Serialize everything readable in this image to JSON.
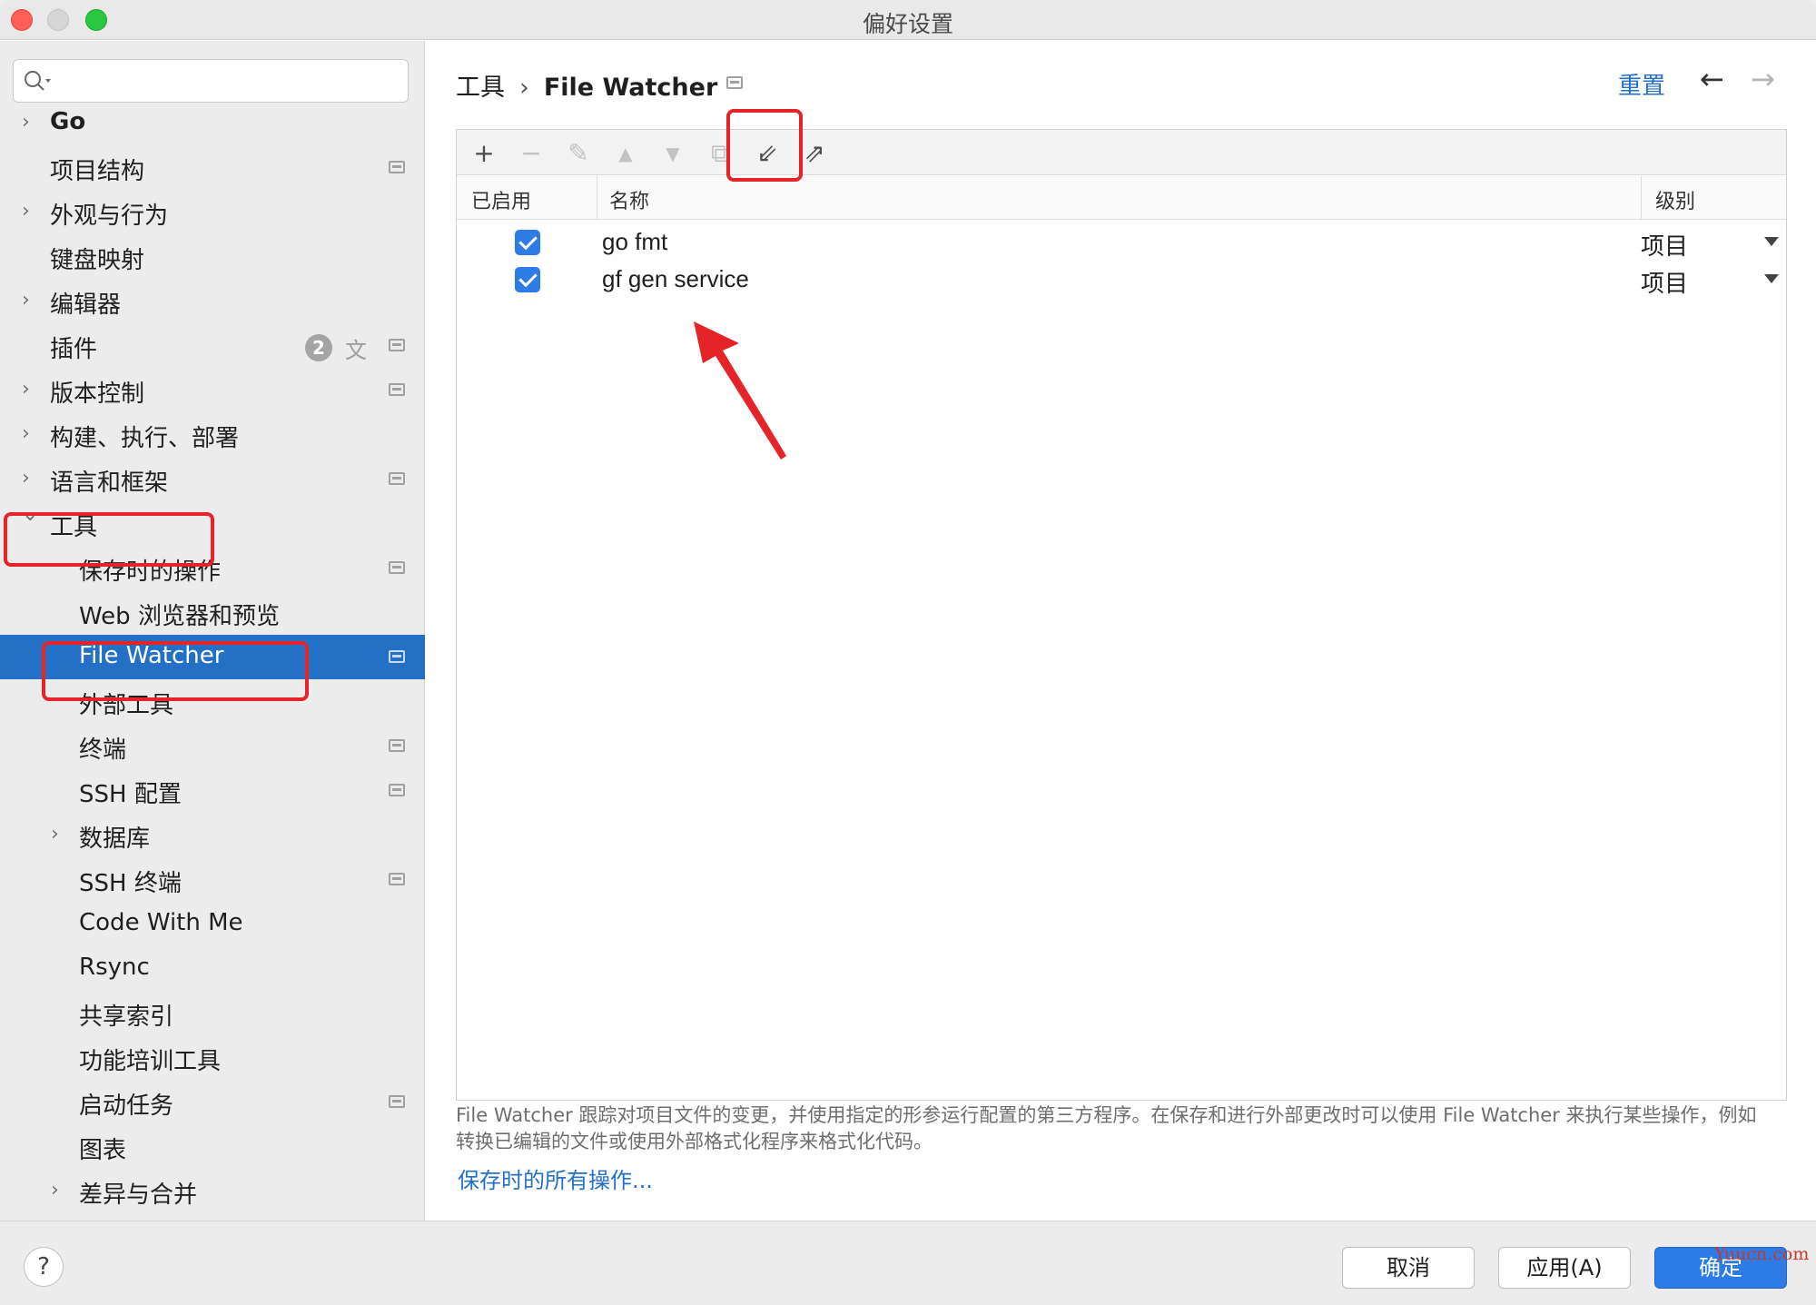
{
  "window": {
    "title": "偏好设置"
  },
  "sidebar": {
    "search_placeholder": "",
    "items": [
      {
        "label": "Go",
        "bold": true,
        "expander": "collapsed",
        "project_icon": false
      },
      {
        "label": "项目结构",
        "expander": "none",
        "project_icon": true
      },
      {
        "label": "外观与行为",
        "expander": "collapsed",
        "project_icon": false
      },
      {
        "label": "键盘映射",
        "expander": "none",
        "project_icon": false
      },
      {
        "label": "编辑器",
        "expander": "collapsed",
        "project_icon": false
      },
      {
        "label": "插件",
        "expander": "none",
        "project_icon": true,
        "badge": "2"
      },
      {
        "label": "版本控制",
        "expander": "collapsed",
        "project_icon": true
      },
      {
        "label": "构建、执行、部署",
        "expander": "collapsed",
        "project_icon": false
      },
      {
        "label": "语言和框架",
        "expander": "collapsed",
        "project_icon": true
      },
      {
        "label": "工具",
        "expander": "expanded",
        "project_icon": false,
        "highlighted": true
      },
      {
        "label": "保存时的操作",
        "expander": "none",
        "indent": 1,
        "project_icon": true
      },
      {
        "label": "Web 浏览器和预览",
        "expander": "none",
        "indent": 1,
        "project_icon": false
      },
      {
        "label": "File Watcher",
        "expander": "none",
        "indent": 1,
        "project_icon": true,
        "selected": true,
        "highlighted": true
      },
      {
        "label": "外部工具",
        "expander": "none",
        "indent": 1,
        "project_icon": false
      },
      {
        "label": "终端",
        "expander": "none",
        "indent": 1,
        "project_icon": true
      },
      {
        "label": "SSH 配置",
        "expander": "none",
        "indent": 1,
        "project_icon": true
      },
      {
        "label": "数据库",
        "expander": "collapsed",
        "indent": 1,
        "project_icon": false
      },
      {
        "label": "SSH 终端",
        "expander": "none",
        "indent": 1,
        "project_icon": true
      },
      {
        "label": "Code With Me",
        "expander": "none",
        "indent": 1,
        "project_icon": false
      },
      {
        "label": "Rsync",
        "expander": "none",
        "indent": 1,
        "project_icon": false
      },
      {
        "label": "共享索引",
        "expander": "none",
        "indent": 1,
        "project_icon": false
      },
      {
        "label": "功能培训工具",
        "expander": "none",
        "indent": 1,
        "project_icon": false
      },
      {
        "label": "启动任务",
        "expander": "none",
        "indent": 1,
        "project_icon": true
      },
      {
        "label": "图表",
        "expander": "none",
        "indent": 1,
        "project_icon": false
      },
      {
        "label": "差异与合并",
        "expander": "collapsed",
        "indent": 1,
        "project_icon": false
      }
    ]
  },
  "content": {
    "breadcrumb": {
      "parent": "工具",
      "separator": "›",
      "current": "File Watcher"
    },
    "reset_label": "重置",
    "toolbar": [
      {
        "icon": "add-icon",
        "glyph": "+",
        "enabled": true
      },
      {
        "icon": "remove-icon",
        "glyph": "−",
        "enabled": false
      },
      {
        "icon": "edit-icon",
        "glyph": "✎",
        "enabled": false
      },
      {
        "icon": "move-up-icon",
        "glyph": "▲",
        "enabled": false
      },
      {
        "icon": "move-down-icon",
        "glyph": "▼",
        "enabled": false
      },
      {
        "icon": "copy-icon",
        "glyph": "⧉",
        "enabled": false
      },
      {
        "icon": "import-icon",
        "glyph": "⇙",
        "enabled": true,
        "highlighted": true
      },
      {
        "icon": "export-icon",
        "glyph": "⇗",
        "enabled": true
      }
    ],
    "table": {
      "headers": {
        "enabled": "已启用",
        "name": "名称",
        "level": "级别"
      },
      "rows": [
        {
          "enabled": true,
          "name": "go fmt",
          "level": "项目"
        },
        {
          "enabled": true,
          "name": "gf gen service",
          "level": "项目"
        }
      ]
    },
    "description": "File Watcher 跟踪对项目文件的变更，并使用指定的形参运行配置的第三方程序。在保存和进行外部更改时可以使用 File Watcher 来执行某些操作，例如转换已编辑的文件或使用外部格式化程序来格式化代码。",
    "link": "保存时的所有操作..."
  },
  "footer": {
    "help_label": "?",
    "cancel_label": "取消",
    "apply_label": "应用(A)",
    "ok_label": "确定"
  },
  "watermark": "Yuucn.com",
  "colors": {
    "accent": "#2470c6",
    "selection": "#2470c6",
    "annotation": "#e5242a"
  }
}
